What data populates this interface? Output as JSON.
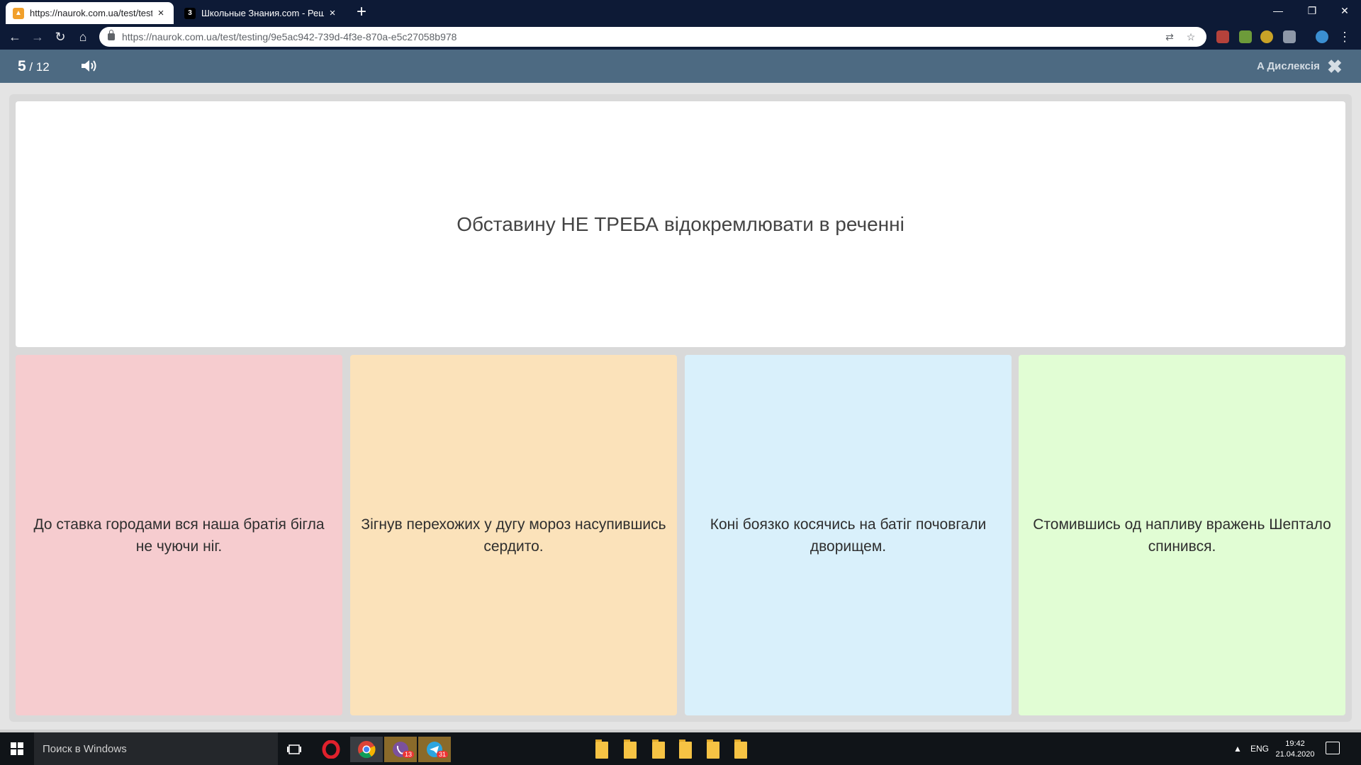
{
  "browser": {
    "tabs": [
      {
        "favicon": "naurok-icon",
        "title": "https://naurok.com.ua/test/testin",
        "active": true
      },
      {
        "favicon": "3",
        "title": "Школьные Знания.com - Решае",
        "active": false
      }
    ],
    "new_tab": "+",
    "url": "https://naurok.com.ua/test/testing/9e5ac942-739d-4f3e-870a-e5c27058b978"
  },
  "app": {
    "counter_current": "5",
    "counter_total": " / 12",
    "dyslexia_label": "A Дислексія",
    "close_icon": "✖"
  },
  "question": {
    "text": "Обставину НЕ ТРЕБА відокремлювати в реченні"
  },
  "answers": [
    {
      "text": "До ставка городами вся наша братія бігла не чуючи ніг.",
      "color": "#f6cccf"
    },
    {
      "text": "Зігнув перехожих у дугу мороз насупившись сердито.",
      "color": "#fbe2ba"
    },
    {
      "text": "Коні боязко косячись на батіг почовгали дворищем.",
      "color": "#d9f0fb"
    },
    {
      "text": "Стомившись од напливу вражень Шептало спинився.",
      "color": "#e1fdd4"
    }
  ],
  "taskbar": {
    "search_placeholder": "Поиск в Windows",
    "language": "ENG",
    "time": "19:42",
    "date": "21.04.2020",
    "viber_badge": "13",
    "telegram_badge": "31"
  },
  "colors": {
    "header": "#4d6a82",
    "tabstrip": "#0d1a36",
    "taskbar": "#101418"
  }
}
